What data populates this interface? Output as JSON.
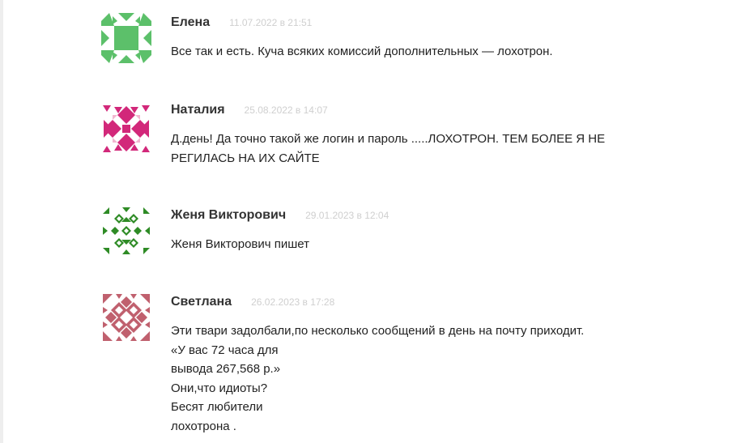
{
  "comments": [
    {
      "author": "Елена",
      "date": "11.07.2022 в 21:51",
      "text_lines": [
        "Все так и есть. Куча всяких комиссий дополнительных — лохотрон."
      ],
      "avatar_color": "#5cc06a"
    },
    {
      "author": "Наталия",
      "date": "25.08.2022 в 14:07",
      "text_lines": [
        "Д.день! Да точно такой же логин и пароль .....ЛОХОТРОН. ТЕМ БОЛЕЕ Я НЕ",
        "РЕГИЛАСЬ НА ИХ САЙТЕ"
      ],
      "avatar_color": "#d2287a"
    },
    {
      "author": "Женя Викторович",
      "date": "29.01.2023 в 12:04",
      "text_lines": [
        "Женя Викторович пишет"
      ],
      "avatar_color": "#2e8b25"
    },
    {
      "author": "Светлана",
      "date": "26.02.2023 в 17:28",
      "text_lines": [
        "Эти твари задолбали,по несколько сообщений в день на почту приходит.",
        "«У вас 72 часа для",
        "вывода 267,568 р.»",
        "Они,что идиоты?",
        "Бесят любители",
        "лохотрона ."
      ],
      "avatar_color": "#c0606e"
    }
  ]
}
